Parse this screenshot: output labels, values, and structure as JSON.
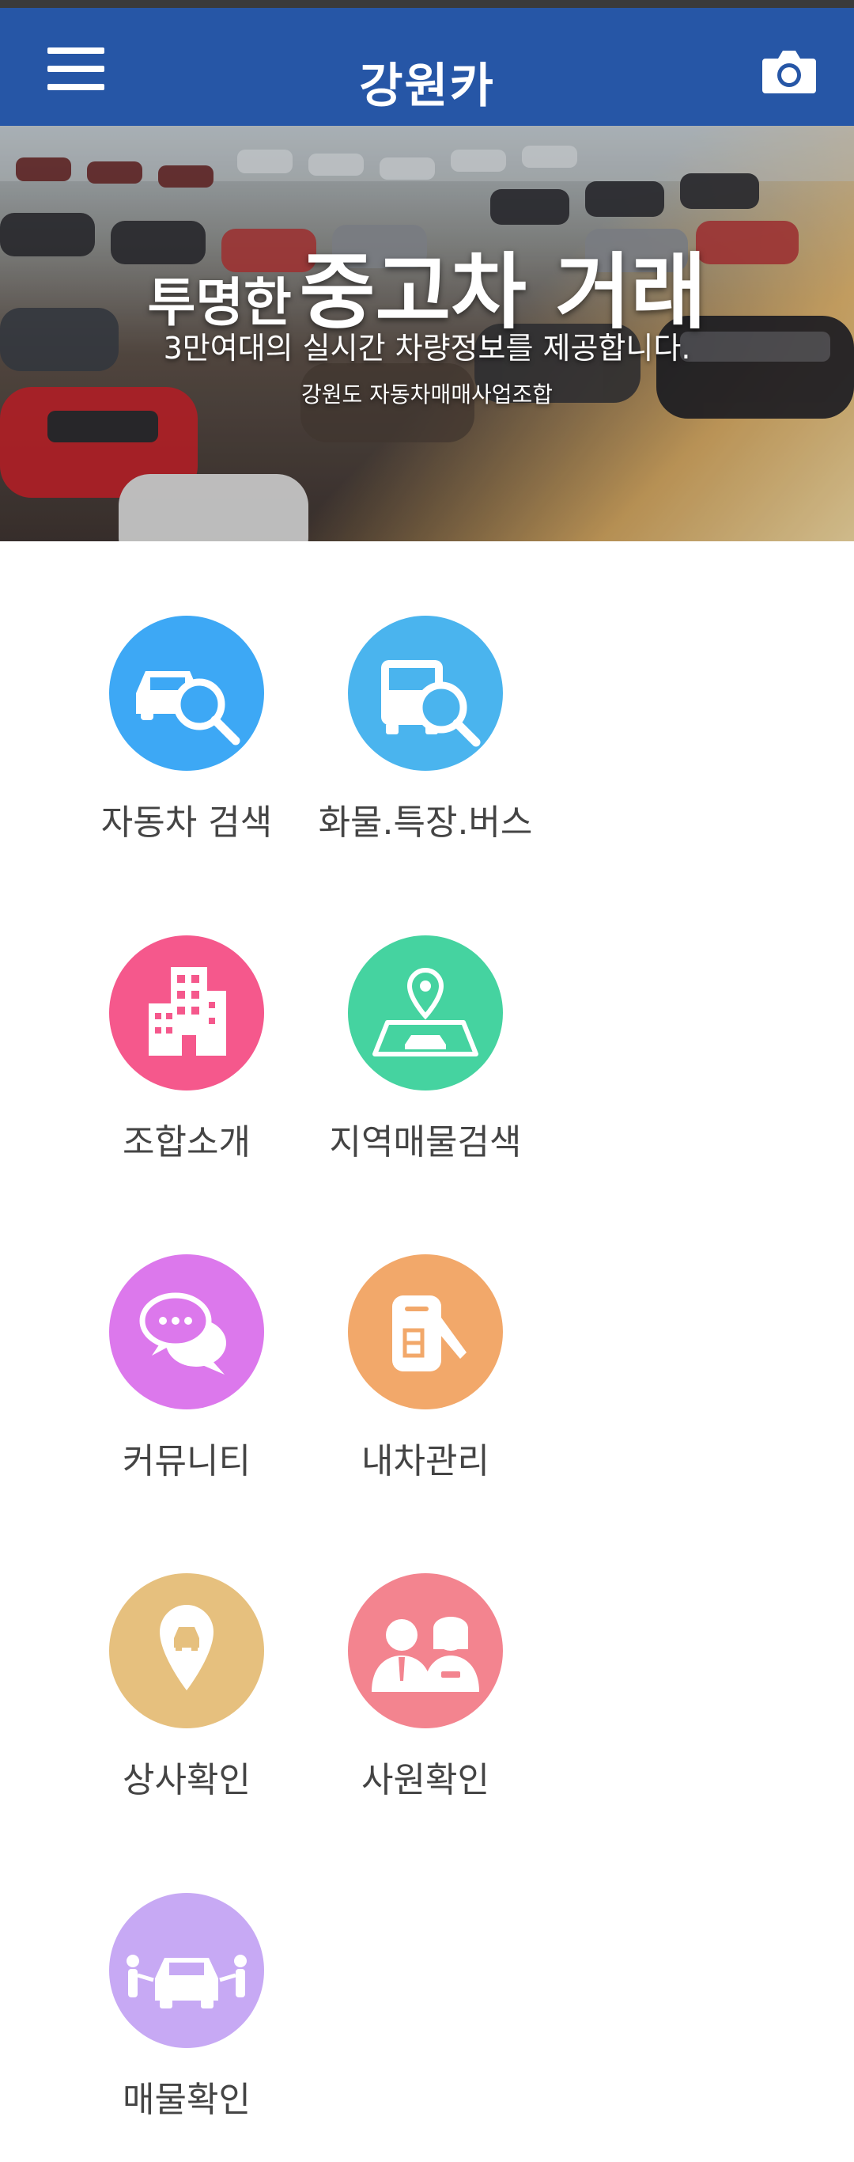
{
  "app": {
    "title": "강원카",
    "menu_icon": "hamburger-menu-icon",
    "camera_icon": "camera-icon",
    "header_color": "#2656a6"
  },
  "hero": {
    "headline_small": "투명한",
    "headline_big": "중고차 거래",
    "subtitle": "3만여대의 실시간 차량정보를 제공합니다.",
    "organization": "강원도 자동차매매사업조합"
  },
  "menu": [
    {
      "label": "자동차 검색",
      "icon": "car-search-icon",
      "color": "#3da8f5"
    },
    {
      "label": "화물.특장.버스",
      "icon": "truck-search-icon",
      "color": "#4ab4ee"
    },
    {
      "label": "조합소개",
      "icon": "building-icon",
      "color": "#f5588c"
    },
    {
      "label": "지역매물검색",
      "icon": "map-pin-car-icon",
      "color": "#45d3a0"
    },
    {
      "label": "커뮤니티",
      "icon": "chat-bubbles-icon",
      "color": "#dc78ec"
    },
    {
      "label": "내차관리",
      "icon": "car-key-icon",
      "color": "#f2a86a"
    },
    {
      "label": "상사확인",
      "icon": "dealer-location-icon",
      "color": "#e6c07e"
    },
    {
      "label": "사원확인",
      "icon": "staff-icon",
      "color": "#f3848f"
    },
    {
      "label": "매물확인",
      "icon": "car-handover-icon",
      "color": "#c7a9f4"
    }
  ]
}
